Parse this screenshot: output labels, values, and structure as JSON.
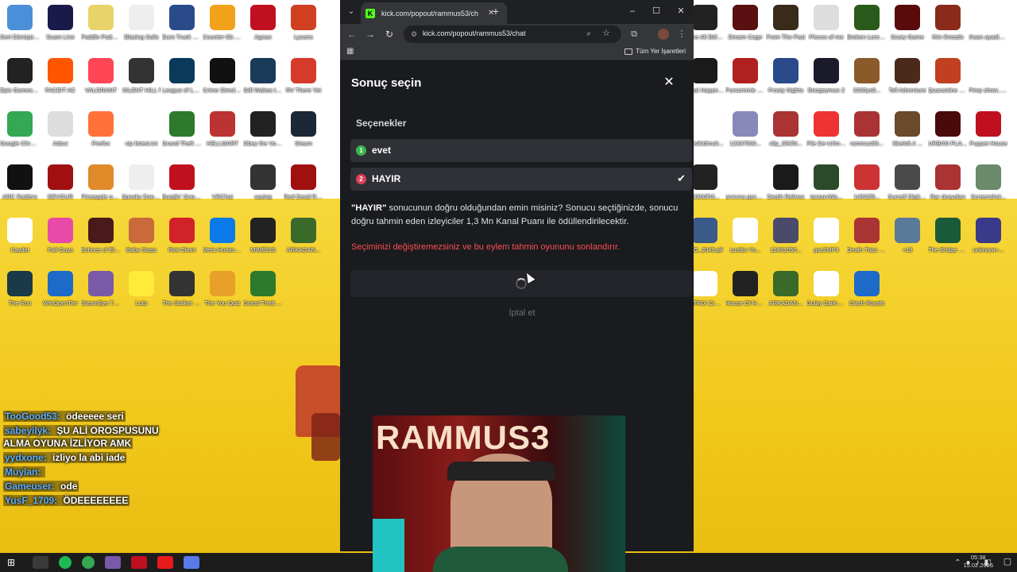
{
  "desktop": {
    "left_icons": [
      {
        "label": "Geri Dönüşüm...",
        "color": "#4a90d9"
      },
      {
        "label": "Scam Line",
        "color": "#1a1a4a"
      },
      {
        "label": "Paddle Paddl...",
        "color": "#e8d36a"
      },
      {
        "label": "Blazing Sails",
        "color": "#eee"
      },
      {
        "label": "Euro Truck Simulator 2",
        "color": "#2a4a8a"
      },
      {
        "label": "Counter-Str... 2",
        "color": "#f2a21a"
      },
      {
        "label": "Agcao",
        "color": "#c01020"
      },
      {
        "label": "Lycans",
        "color": "#d04020"
      },
      {
        "label": "Epic Games Launcher",
        "color": "#222"
      },
      {
        "label": "FACEIT AC",
        "color": "#ff5500"
      },
      {
        "label": "VALORANT",
        "color": "#ff4655"
      },
      {
        "label": "SILENT HILL f",
        "color": "#333"
      },
      {
        "label": "League of Legends",
        "color": "#0a3a5a"
      },
      {
        "label": "Crime Simulator",
        "color": "#111"
      },
      {
        "label": "Still Wakes the Deep",
        "color": "#1a3a5a"
      },
      {
        "label": "RV There Yet",
        "color": "#d53a2a"
      },
      {
        "label": "Google Chrome",
        "color": "#34a853"
      },
      {
        "label": "Adsız",
        "color": "#ddd"
      },
      {
        "label": "Firefox",
        "color": "#ff7139"
      },
      {
        "label": "vip listesi.txt",
        "color": "#fff"
      },
      {
        "label": "Grand Theft Auto V En...",
        "color": "#2d7a2d"
      },
      {
        "label": "HELLMART",
        "color": "#b33"
      },
      {
        "label": "Obey the Voice",
        "color": "#222"
      },
      {
        "label": "Steam",
        "color": "#1b2838"
      },
      {
        "label": "ARC Raiders",
        "color": "#111"
      },
      {
        "label": "DEVOUR",
        "color": "#a01010"
      },
      {
        "label": "Pineapple on pizza",
        "color": "#e08a2a"
      },
      {
        "label": "Spooky Dookie",
        "color": "#eee"
      },
      {
        "label": "Burglin' Gnom...",
        "color": "#c01020"
      },
      {
        "label": "VRChat",
        "color": "#fff"
      },
      {
        "label": "saying",
        "color": "#333"
      },
      {
        "label": "Red Dead Redempti...",
        "color": "#a01010"
      },
      {
        "label": "Kaydet",
        "color": "#fff"
      },
      {
        "label": "Fall Guys",
        "color": "#e84aa8"
      },
      {
        "label": "Echoes of Elysium",
        "color": "#4a1a1a"
      },
      {
        "label": "Baby Steps",
        "color": "#c86a3a"
      },
      {
        "label": "Riot Client",
        "color": "#d1222a"
      },
      {
        "label": "Meta Horizon Link",
        "color": "#0a7aea"
      },
      {
        "label": "MIMESIS",
        "color": "#222"
      },
      {
        "label": "ARKADAN...",
        "color": "#3a6a2a"
      },
      {
        "label": "The Run",
        "color": "#1a3a4a"
      },
      {
        "label": "WinOpenTier",
        "color": "#1e6ac8"
      },
      {
        "label": "SteamEye Tracker",
        "color": "#7a5aa8"
      },
      {
        "label": "Luto",
        "color": "#ffea3a"
      },
      {
        "label": "The Stalker 3 Demo",
        "color": "#333"
      },
      {
        "label": "The You Quiz",
        "color": "#e8a02a"
      },
      {
        "label": "Grand Theft Auto V Le...",
        "color": "#2d7a2d"
      }
    ],
    "right_icons": [
      {
        "label": "Kime Alt Bölüm",
        "color": "#222"
      },
      {
        "label": "Dream Cage",
        "color": "#5a1010"
      },
      {
        "label": "From The Past",
        "color": "#3a2a1a"
      },
      {
        "label": "Pieces of me",
        "color": "#ddd"
      },
      {
        "label": "Broken Lore DON'T W...",
        "color": "#2a5a1a"
      },
      {
        "label": "Scary Game",
        "color": "#5a0a0a"
      },
      {
        "label": "thin threads",
        "color": "#8a2a1a"
      },
      {
        "label": "ıhsan ayadim.MP3",
        "color": "#fff"
      },
      {
        "label": "What Happened...",
        "color": "#1a1a1a"
      },
      {
        "label": "Pursommie No REMI - Pi...",
        "color": "#b02020"
      },
      {
        "label": "Frosty Nights",
        "color": "#2a4a8a"
      },
      {
        "label": "Boogeyman 2",
        "color": "#1a1a2a"
      },
      {
        "label": "3330ys8...",
        "color": "#8a5a2a"
      },
      {
        "label": "Tell Adventure",
        "color": "#4a2a1a"
      },
      {
        "label": "Quarantine Zone The...",
        "color": "#c04020"
      },
      {
        "label": "Pimp show... (1).mp3",
        "color": "#fff"
      },
      {
        "label": "sikisikidimsk...",
        "color": "#fff"
      },
      {
        "label": "12337560...",
        "color": "#88b"
      },
      {
        "label": "clip_SİKİN...",
        "color": "#a33"
      },
      {
        "label": "File De-Urlmed",
        "color": "#e33"
      },
      {
        "label": "rammus53...",
        "color": "#a33"
      },
      {
        "label": "Skelo5.4 ...",
        "color": "#6a4a2a"
      },
      {
        "label": "URBAN PLAYS",
        "color": "#4a0a0a"
      },
      {
        "label": "Puppet House",
        "color": "#c01020"
      },
      {
        "label": "33366fh5...",
        "color": "#222"
      },
      {
        "label": "anınına geceli...",
        "color": "#fff"
      },
      {
        "label": "Death Relives",
        "color": "#1a1a1a"
      },
      {
        "label": "tarzanıWa...",
        "color": "#2a4a2a"
      },
      {
        "label": "14932f6...",
        "color": "#c33"
      },
      {
        "label": "Gurcell Digitales...",
        "color": "#4a4a4a"
      },
      {
        "label": "Rar dosyaları",
        "color": "#a33"
      },
      {
        "label": "Screenshot...",
        "color": "#6a8a6a"
      },
      {
        "label": "IMG_2049.gif",
        "color": "#3a5a8a"
      },
      {
        "label": "sustbu Yo...",
        "color": "#fff"
      },
      {
        "label": "12491050...",
        "color": "#4a4a6a"
      },
      {
        "label": "gsc2MP3",
        "color": "#fff"
      },
      {
        "label": "Death Trips (Windows)...",
        "color": "#a33"
      },
      {
        "label": "+18",
        "color": "#5a7a9a"
      },
      {
        "label": "The Bridge Curse 2 Th...",
        "color": "#1a5a3a"
      },
      {
        "label": "unknown-...",
        "color": "#3a3a8a"
      },
      {
        "label": "MATRIX ÇIÇ RAMMUS...",
        "color": "#fff"
      },
      {
        "label": "House Of Horror Gu...",
        "color": "#222"
      },
      {
        "label": "ARKADAN...",
        "color": "#3a6a2a"
      },
      {
        "label": "Gulay Şarkısı Gulay f...",
        "color": "#fff"
      },
      {
        "label": "Clash Royale",
        "color": "#1e6ac8"
      }
    ],
    "chat_messages": [
      {
        "user": "TooGood53:",
        "text": "ödeeeee seri"
      },
      {
        "user": "sabeyilyk:",
        "text": "ŞU ALİ OROSPUSUNU ALMA OYUNA İZLİYOR AMK"
      },
      {
        "user": "yydxone:",
        "text": "izliyo la abi iade"
      },
      {
        "user": "Muylan:",
        "text": ""
      },
      {
        "user": "Gameuser:",
        "text": "ode"
      },
      {
        "user": "YusF_1709:",
        "text": "ÖDEEEEEEEE"
      }
    ],
    "taskbar": {
      "time": "05:38",
      "date": "15.02.2026"
    }
  },
  "browser": {
    "tab_title": "kick.com/popout/rammus53/ch",
    "url": "kick.com/popout/rammus53/chat",
    "bookmarks_all_label": "Tüm Yer İşaretleri"
  },
  "modal": {
    "title": "Sonuç seçin",
    "section_label": "Seçenekler",
    "options": [
      {
        "number": "1",
        "label": "evet",
        "badge_color": "#3bb54a",
        "selected": false
      },
      {
        "number": "2",
        "label": "HAYIR",
        "badge_color": "#e0405a",
        "selected": true
      }
    ],
    "confirm_quoted": "\"HAYIR\"",
    "confirm_text": "sonucunun doğru olduğundan emin misiniz? Sonucu seçtiğinizde, sonucu doğru tahmin eden izleyiciler 1,3 Mn Kanal Puanı ile ödüllendirilecektir.",
    "warning_text": "Seçiminizi değiştiremezsiniz ve bu eylem tahmin oyununu sonlandırır.",
    "cancel_label": "İptal et"
  },
  "webcam": {
    "overlay_text": "RAMMUS3"
  },
  "colors": {
    "modal_bg": "#191b1f",
    "option_bg": "#2f3136",
    "warning": "#ff4e4e",
    "kick_green": "#53fc18"
  }
}
